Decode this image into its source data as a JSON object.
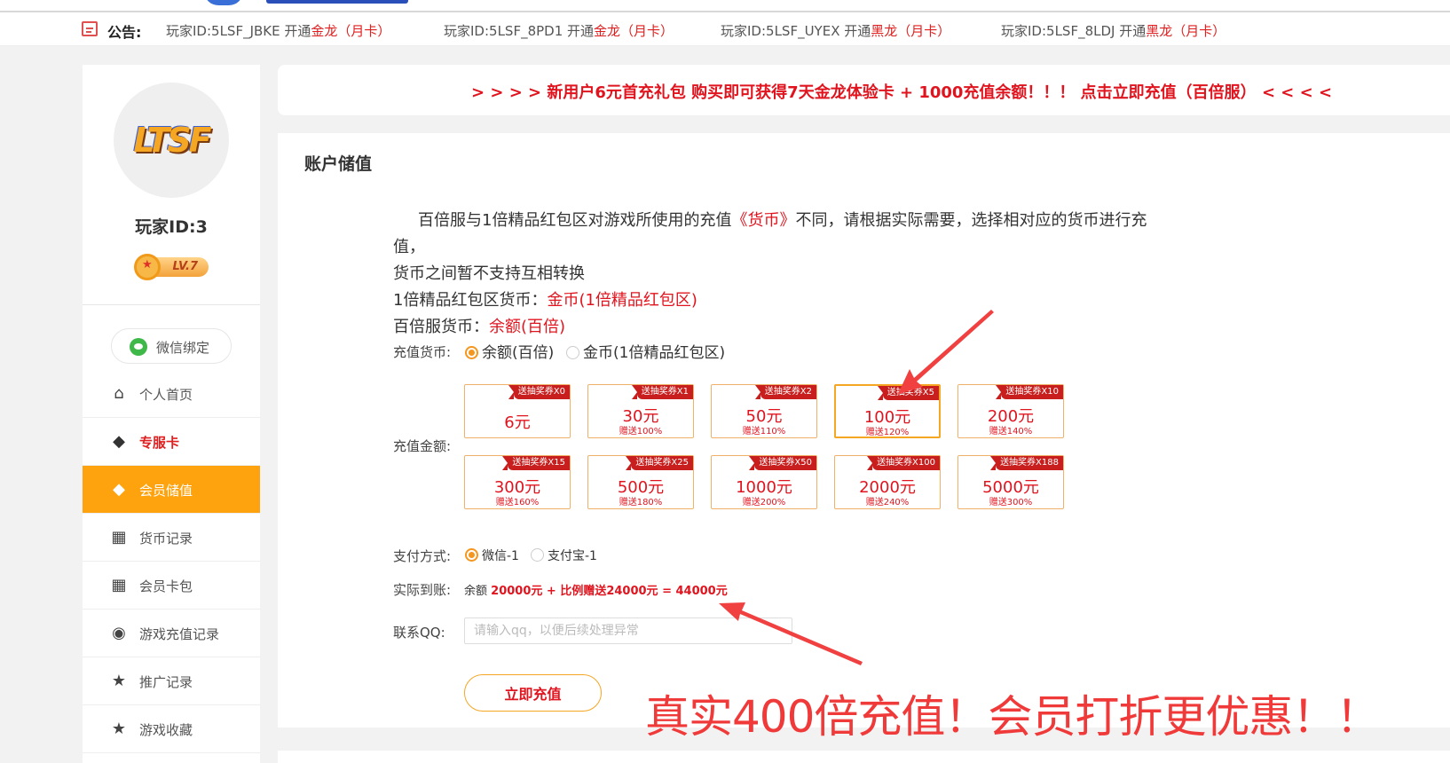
{
  "notice": {
    "label": "公告:",
    "items": [
      {
        "prefix": "玩家ID:5LSF_JBKE 开通",
        "highlight": "金龙",
        "suffix": "（月卡）"
      },
      {
        "prefix": "玩家ID:5LSF_8PD1 开通",
        "highlight": "金龙",
        "suffix": "（月卡）"
      },
      {
        "prefix": "玩家ID:5LSF_UYEX 开通",
        "highlight": "黑龙",
        "suffix": "（月卡）"
      },
      {
        "prefix": "玩家ID:5LSF_8LDJ 开通",
        "highlight": "黑龙",
        "suffix": "（月卡）"
      }
    ]
  },
  "sidebar": {
    "avatar_text": "LTSF",
    "player_id": "玩家ID:3",
    "level": "LV.7",
    "wechat_bind": "微信绑定",
    "items": [
      {
        "label": "个人首页",
        "icon": "home-icon",
        "glyph": "⌂"
      },
      {
        "label": "专服卡",
        "icon": "diamond-icon",
        "glyph": "◆"
      },
      {
        "label": "会员储值",
        "icon": "diamond-icon",
        "glyph": "◆"
      },
      {
        "label": "货币记录",
        "icon": "ticket-icon",
        "glyph": "▦"
      },
      {
        "label": "会员卡包",
        "icon": "ticket-icon",
        "glyph": "▦"
      },
      {
        "label": "游戏充值记录",
        "icon": "gamepad-icon",
        "glyph": "◉"
      },
      {
        "label": "推广记录",
        "icon": "star-icon",
        "glyph": "★"
      },
      {
        "label": "游戏收藏",
        "icon": "star-icon",
        "glyph": "★"
      }
    ]
  },
  "banner": {
    "text": "> > > >   新用户6元首充礼包 购买即可获得7天金龙体验卡 + 1000充值余额！！！ 点击立即充值（百倍服）   < < < <"
  },
  "main": {
    "title": "账户储值",
    "desc_line1_a": "百倍服与1倍精品红包区对游戏所使用的充值",
    "desc_line1_red": "《货币》",
    "desc_line1_b": "不同，请根据实际需要，选择相对应的货币进行充值，",
    "desc_line2": "货币之间暂不支持互相转换",
    "desc_line3_a": "1倍精品红包区货币：",
    "desc_line3_red": "金币(1倍精品红包区)",
    "desc_line4_a": "百倍服货币：",
    "desc_line4_red": "余额(百倍)",
    "currency_label": "充值货币:",
    "currency_options": [
      "余额(百倍)",
      "金币(1倍精品红包区)"
    ],
    "amount_label": "充值金额:",
    "amounts": [
      {
        "tag": "送抽奖券X0",
        "value": "6元",
        "bonus": ""
      },
      {
        "tag": "送抽奖券X1",
        "value": "30元",
        "bonus": "赠送100%"
      },
      {
        "tag": "送抽奖券X2",
        "value": "50元",
        "bonus": "赠送110%"
      },
      {
        "tag": "送抽奖券X5",
        "value": "100元",
        "bonus": "赠送120%"
      },
      {
        "tag": "送抽奖券X10",
        "value": "200元",
        "bonus": "赠送140%"
      },
      {
        "tag": "送抽奖券X15",
        "value": "300元",
        "bonus": "赠送160%"
      },
      {
        "tag": "送抽奖券X25",
        "value": "500元",
        "bonus": "赠送180%"
      },
      {
        "tag": "送抽奖券X50",
        "value": "1000元",
        "bonus": "赠送200%"
      },
      {
        "tag": "送抽奖券X100",
        "value": "2000元",
        "bonus": "赠送240%"
      },
      {
        "tag": "送抽奖券X188",
        "value": "5000元",
        "bonus": "赠送300%"
      }
    ],
    "selected_amount_index": 3,
    "pay_label": "支付方式:",
    "pay_options": [
      "微信-1",
      "支付宝-1"
    ],
    "actual_label": "实际到账:",
    "actual_prefix": "余额",
    "actual_value": "20000元 + 比例赠送24000元 = 44000元",
    "qq_label": "联系QQ:",
    "qq_placeholder": "请输入qq，以便后续处理异常",
    "submit_label": "立即充值",
    "promo_text": "真实400倍充值！会员打折更优惠！！"
  },
  "colors": {
    "accent": "#fea30e",
    "red": "#e0141e",
    "wechat": "#3fb84a"
  }
}
